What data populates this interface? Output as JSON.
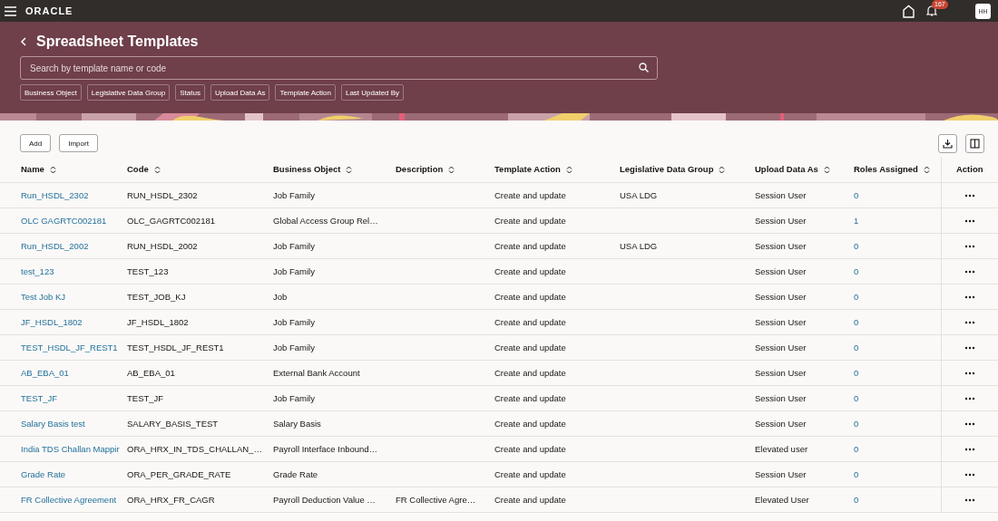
{
  "topbar": {
    "logo": "ORACLE",
    "notification_count": "167",
    "avatar": "HH"
  },
  "page": {
    "title": "Spreadsheet Templates",
    "search": {
      "placeholder": "Search by template name or code"
    },
    "filters": [
      "Business Object",
      "Legislative Data Group",
      "Status",
      "Upload Data As",
      "Template Action",
      "Last Updated By"
    ]
  },
  "toolbar": {
    "buttons": [
      "Add",
      "Import"
    ]
  },
  "table": {
    "columns": [
      {
        "label": "Name",
        "sortable": true
      },
      {
        "label": "Code",
        "sortable": true
      },
      {
        "label": "Business Object",
        "sortable": true
      },
      {
        "label": "Description",
        "sortable": true
      },
      {
        "label": "Template Action",
        "sortable": true
      },
      {
        "label": "Legislative Data Group",
        "sortable": true
      },
      {
        "label": "Upload Data As",
        "sortable": true
      },
      {
        "label": "Roles Assigned",
        "sortable": true
      },
      {
        "label": "Action",
        "sortable": false
      }
    ],
    "rows": [
      [
        "Run_HSDL_2302",
        "RUN_HSDL_2302",
        "Job Family",
        "",
        "Create and update",
        "USA LDG",
        "Session User",
        "0"
      ],
      [
        "OLC GAGRTC002181",
        "OLC_GAGRTC002181",
        "Global Access Group Rel…",
        "",
        "Create and update",
        "",
        "Session User",
        "1"
      ],
      [
        "Run_HSDL_2002",
        "RUN_HSDL_2002",
        "Job Family",
        "",
        "Create and update",
        "USA LDG",
        "Session User",
        "0"
      ],
      [
        "test_123",
        "TEST_123",
        "Job Family",
        "",
        "Create and update",
        "",
        "Session User",
        "0"
      ],
      [
        "Test Job KJ",
        "TEST_JOB_KJ",
        "Job",
        "",
        "Create and update",
        "",
        "Session User",
        "0"
      ],
      [
        "JF_HSDL_1802",
        "JF_HSDL_1802",
        "Job Family",
        "",
        "Create and update",
        "",
        "Session User",
        "0"
      ],
      [
        "TEST_HSDL_JF_REST1",
        "TEST_HSDL_JF_REST1",
        "Job Family",
        "",
        "Create and update",
        "",
        "Session User",
        "0"
      ],
      [
        "AB_EBA_01",
        "AB_EBA_01",
        "External Bank Account",
        "",
        "Create and update",
        "",
        "Session User",
        "0"
      ],
      [
        "TEST_JF",
        "TEST_JF",
        "Job Family",
        "",
        "Create and update",
        "",
        "Session User",
        "0"
      ],
      [
        "Salary Basis test",
        "SALARY_BASIS_TEST",
        "Salary Basis",
        "",
        "Create and update",
        "",
        "Session User",
        "0"
      ],
      [
        "India TDS Challan Mappir",
        "ORA_HRX_IN_TDS_CHALLAN_…",
        "Payroll Interface Inbound…",
        "",
        "Create and update",
        "",
        "Elevated user",
        "0"
      ],
      [
        "Grade Rate",
        "ORA_PER_GRADE_RATE",
        "Grade Rate",
        "",
        "Create and update",
        "",
        "Session User",
        "0"
      ],
      [
        "FR Collective Agreement",
        "ORA_HRX_FR_CAGR",
        "Payroll Deduction Value …",
        "FR Collective Agre…",
        "Create and update",
        "",
        "Elevated User",
        "0"
      ]
    ]
  }
}
